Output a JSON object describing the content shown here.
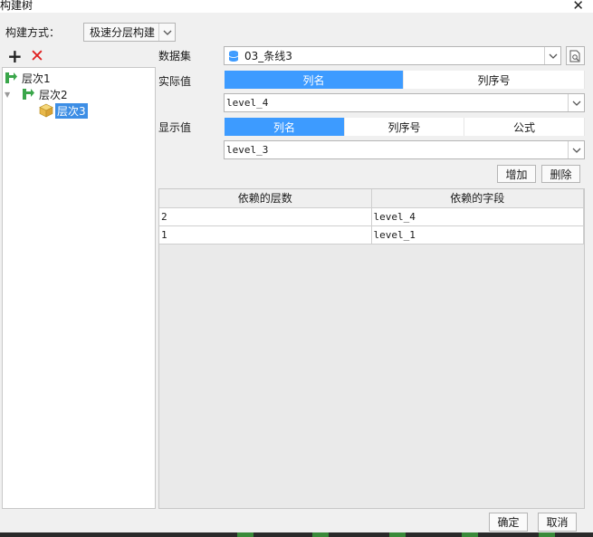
{
  "window": {
    "title": "构建树",
    "close_symbol": "✕"
  },
  "build_mode": {
    "label": "构建方式：",
    "value": "极速分层构建"
  },
  "toolbar": {
    "add_symbol": "+",
    "delete_symbol": "✕"
  },
  "tree": {
    "items": [
      {
        "label": "层次1"
      },
      {
        "label": "层次2"
      },
      {
        "label": "层次3"
      }
    ]
  },
  "dataset": {
    "label": "数据集",
    "value": "03_条线3"
  },
  "actual_value": {
    "label": "实际值",
    "tabs": [
      "列名",
      "列序号"
    ],
    "active_tab": 0,
    "field_value": "level_4"
  },
  "display_value": {
    "label": "显示值",
    "tabs": [
      "列名",
      "列序号",
      "公式"
    ],
    "active_tab": 0,
    "field_value": "level_3"
  },
  "actions": {
    "add": "增加",
    "delete": "删除"
  },
  "dependency_table": {
    "headers": [
      "依赖的层数",
      "依赖的字段"
    ],
    "rows": [
      [
        "2",
        "level_4"
      ],
      [
        "1",
        "level_1"
      ]
    ]
  },
  "footer": {
    "ok": "确定",
    "cancel": "取消"
  },
  "colors": {
    "accent": "#3d9bff",
    "selection": "#3d8ee5",
    "delete_red": "#e02020",
    "tree_green": "#3aa64a"
  }
}
